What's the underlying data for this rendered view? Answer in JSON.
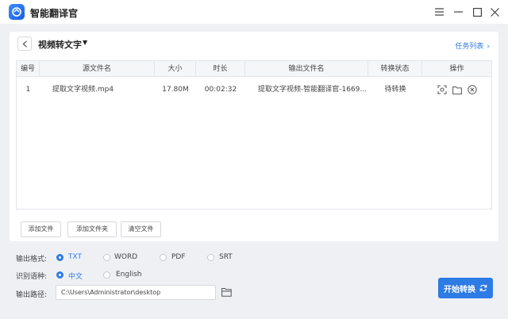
{
  "app": {
    "title": "智能翻译官"
  },
  "header": {
    "page_title": "视频转文字",
    "task_list": "任务列表"
  },
  "table": {
    "columns": [
      "编号",
      "源文件名",
      "大小",
      "时长",
      "输出文件名",
      "转换状态",
      "操作"
    ],
    "rows": [
      {
        "index": "1",
        "source": "提取文字视频.mp4",
        "size": "17.80M",
        "duration": "00:02:32",
        "output": "提取文字视频-智能翻译官-1669...",
        "status": "待转换"
      }
    ]
  },
  "actions": {
    "add_file": "添加文件",
    "add_folder": "添加文件夹",
    "clear_files": "清空文件"
  },
  "options": {
    "format_label": "输出格式:",
    "formats": [
      "TXT",
      "WORD",
      "PDF",
      "SRT"
    ],
    "selected_format": "TXT",
    "lang_label": "识别语种:",
    "languages": [
      "中文",
      "English"
    ],
    "selected_language": "中文",
    "path_label": "输出路径:",
    "path_value": "C:\\Users\\Administrator\\desktop"
  },
  "start_button": "开始转换",
  "colors": {
    "accent": "#2d7be5"
  }
}
